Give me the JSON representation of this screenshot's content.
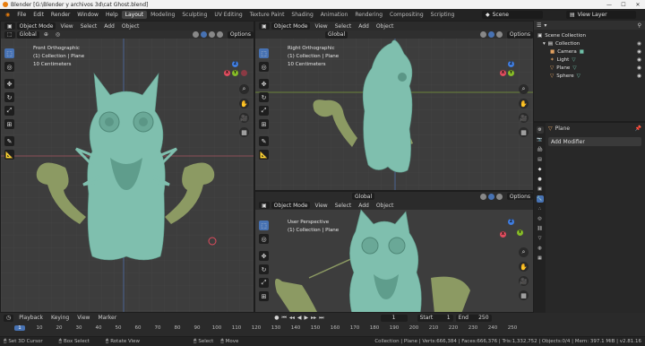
{
  "window": {
    "title": "Blender [G:\\Blender y archivos 3d\\cat Ghost.blend]",
    "controls": [
      "—",
      "☐",
      "✕"
    ]
  },
  "menus": [
    "File",
    "Edit",
    "Render",
    "Window",
    "Help"
  ],
  "workspaces": [
    "Layout",
    "Modeling",
    "Sculpting",
    "UV Editing",
    "Texture Paint",
    "Shading",
    "Animation",
    "Rendering",
    "Compositing",
    "Scripting"
  ],
  "active_workspace": "Layout",
  "scene": {
    "name": "Scene",
    "view_layer": "View Layer"
  },
  "viewport_header": {
    "mode": "Object Mode",
    "menus": [
      "View",
      "Select",
      "Add",
      "Object"
    ],
    "orientation": "Global",
    "options": "Options"
  },
  "viewports": {
    "front": {
      "title": "Front Orthographic",
      "collection": "(1) Collection | Plane",
      "scale": "10 Centimeters"
    },
    "right": {
      "title": "Right Orthographic",
      "collection": "(1) Collection | Plane",
      "scale": "10 Centimeters"
    },
    "persp": {
      "title": "User Perspective",
      "collection": "(1) Collection | Plane"
    }
  },
  "gizmo_axes": {
    "x": "X",
    "y": "Y",
    "z": "Z"
  },
  "outliner": {
    "root": "Scene Collection",
    "collection": "Collection",
    "items": [
      "Camera",
      "Light",
      "Plane",
      "Sphere"
    ]
  },
  "properties": {
    "object_name": "Plane",
    "add_modifier": "Add Modifier"
  },
  "timeline": {
    "menus": [
      "Playback",
      "Keying",
      "View",
      "Marker"
    ],
    "current_frame": "1",
    "start_label": "Start",
    "start": "1",
    "end_label": "End",
    "end": "250",
    "ticks": [
      "1",
      "10",
      "20",
      "30",
      "40",
      "50",
      "60",
      "70",
      "80",
      "90",
      "100",
      "110",
      "120",
      "130",
      "140",
      "150",
      "160",
      "170",
      "180",
      "190",
      "200",
      "210",
      "220",
      "230",
      "240",
      "250"
    ]
  },
  "status": {
    "left": [
      "Set 3D Cursor",
      "Box Select",
      "Rotate View",
      "Select",
      "Move"
    ],
    "stats": "Collection | Plane | Verts:666,384 | Faces:666,376 | Tris:1,332,752 | Objects:0/4 | Mem: 397.1 MiB | v2.81.16"
  },
  "colors": {
    "accent": "#4772b3",
    "ghost": "#7fbfae",
    "arms": "#8c9a63",
    "x_axis": "#e04c5e",
    "y_axis": "#86bb27",
    "z_axis": "#3f7de1",
    "playhead": "#4772b3"
  }
}
